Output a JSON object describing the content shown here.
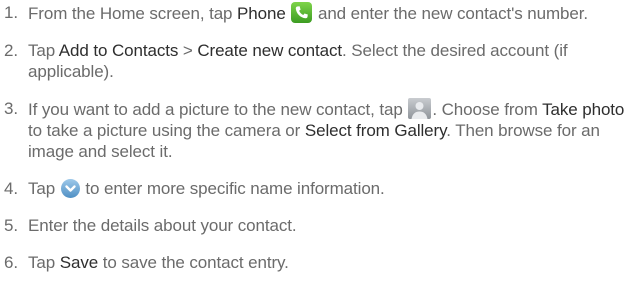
{
  "steps": [
    {
      "num": "1.",
      "t1": "From the Home screen, tap ",
      "b1": "Phone",
      "t2": " and enter the new contact's number."
    },
    {
      "num": "2.",
      "t1": "Tap ",
      "b1": "Add to Contacts",
      "t2": " > ",
      "b2": "Create new contact",
      "t3": ". Select the desired account (if applicable)."
    },
    {
      "num": "3.",
      "t1": "If you want to add a picture to the new contact, tap ",
      "t2": ". Choose from ",
      "b1": "Take photo",
      "t3": " to take a picture using the camera or ",
      "b2": "Select from Gallery",
      "t4": ". Then browse for an image and select it."
    },
    {
      "num": "4.",
      "t1": "Tap ",
      "t2": " to enter more specific name information."
    },
    {
      "num": "5.",
      "t1": "Enter the details about your contact."
    },
    {
      "num": "6.",
      "t1": "Tap ",
      "b1": "Save",
      "t2": " to save the contact entry."
    }
  ],
  "icons": {
    "phone": "phone-icon",
    "contact_picture": "contact-picture-icon",
    "expand": "chevron-down-icon"
  },
  "colors": {
    "text": "#6b6b6b",
    "emphasis": "#2e2e2e",
    "phone_icon": "#4cae2c",
    "expand_icon": "#5b9bd0"
  }
}
